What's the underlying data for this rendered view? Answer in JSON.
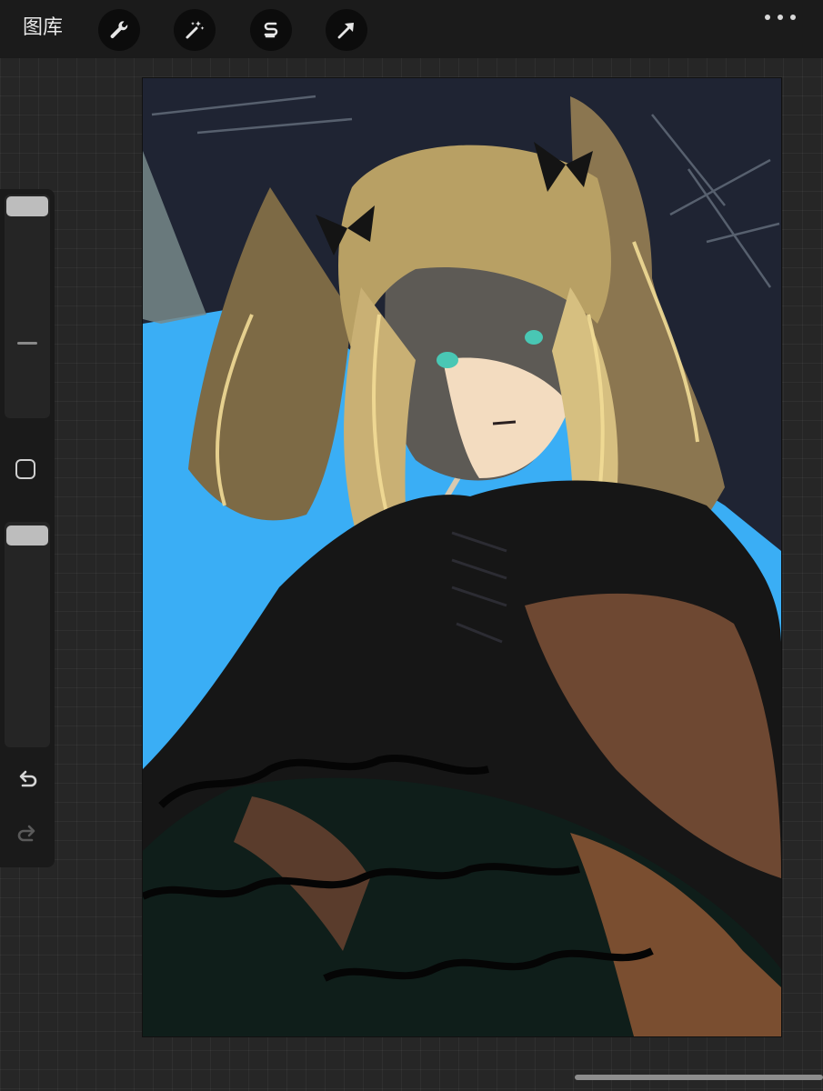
{
  "topbar": {
    "gallery_label": "图库",
    "tools": [
      {
        "name": "wrench-icon"
      },
      {
        "name": "magic-wand-icon"
      },
      {
        "name": "selection-s-icon"
      },
      {
        "name": "move-arrow-icon"
      }
    ],
    "more_icon": "ellipsis-icon"
  },
  "sidebar": {
    "brush_size_level": 0.0,
    "opacity_level": 0.0,
    "modify_button_icon": "square-icon",
    "undo_icon": "undo-icon",
    "redo_icon": "redo-icon"
  },
  "canvas": {
    "subject": "artwork",
    "colors": {
      "background_sky": "#3aaef5",
      "dark_navy": "#1f2433",
      "hair": "#b8a064",
      "hair_highlight": "#f2dc96",
      "dress_dark": "#161616",
      "dress_brown": "#6e4832",
      "skin": "#f3dcc0",
      "eyes": "#49c7b4"
    }
  }
}
